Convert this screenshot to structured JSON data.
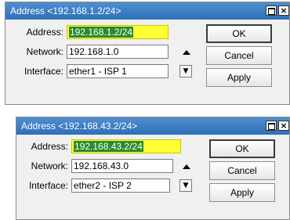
{
  "windows": [
    {
      "title": "Address <192.168.1.2/24>",
      "fields": {
        "address_label": "Address:",
        "address_value": "192.168.1.2/24",
        "network_label": "Network:",
        "network_value": "192.168.1.0",
        "interface_label": "Interface:",
        "interface_value": "ether1 - ISP 1"
      },
      "buttons": {
        "ok": "OK",
        "cancel": "Cancel",
        "apply": "Apply"
      },
      "titlebar_buttons": {
        "close": "×"
      }
    },
    {
      "title": "Address <192.168.43.2/24>",
      "fields": {
        "address_label": "Address:",
        "address_value": "192.168.43.2/24",
        "network_label": "Network:",
        "network_value": "192.168.43.0",
        "interface_label": "Interface:",
        "interface_value": "ether2 - ISP 2"
      },
      "buttons": {
        "ok": "OK",
        "cancel": "Cancel",
        "apply": "Apply"
      },
      "titlebar_buttons": {
        "close": "×"
      }
    }
  ],
  "colors": {
    "titlebar": "#2f6fb8",
    "highlight": "#ffff33",
    "selection": "#2b8a2b"
  },
  "icons": {
    "network_arrow": "up-triangle-icon",
    "interface_dropdown": "dropdown-icon",
    "maximize": "maximize-icon",
    "close": "close-icon"
  }
}
